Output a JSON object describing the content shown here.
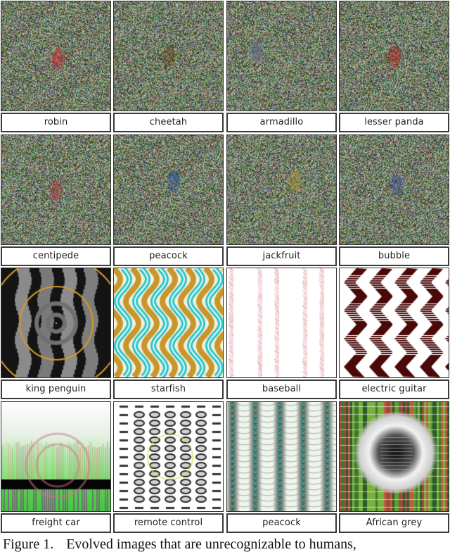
{
  "figure": {
    "rows": [
      {
        "style": "noise",
        "cells": [
          {
            "label": "robin",
            "blob_color": "#c0393a",
            "blob_pos": [
              0.52,
              0.52
            ]
          },
          {
            "label": "cheetah",
            "blob_color": "#6a5030",
            "blob_pos": [
              0.5,
              0.5
            ]
          },
          {
            "label": "armadillo",
            "blob_color": "#6b6f80",
            "blob_pos": [
              0.27,
              0.45
            ]
          },
          {
            "label": "lesser panda",
            "blob_color": "#a03a30",
            "blob_pos": [
              0.5,
              0.5
            ]
          }
        ]
      },
      {
        "style": "noise",
        "cells": [
          {
            "label": "centipede",
            "blob_color": "#a04a4a",
            "blob_pos": [
              0.5,
              0.5
            ]
          },
          {
            "label": "peacock",
            "blob_color": "#3a5a8a",
            "blob_pos": [
              0.55,
              0.42
            ]
          },
          {
            "label": "jackfruit",
            "blob_color": "#9a8a3a",
            "blob_pos": [
              0.62,
              0.42
            ]
          },
          {
            "label": "bubble",
            "blob_color": "#4a5a8a",
            "blob_pos": [
              0.52,
              0.45
            ]
          }
        ]
      },
      {
        "style": "pattern",
        "cells": [
          {
            "label": "king penguin",
            "pattern": "king-penguin"
          },
          {
            "label": "starfish",
            "pattern": "starfish"
          },
          {
            "label": "baseball",
            "pattern": "baseball"
          },
          {
            "label": "electric guitar",
            "pattern": "electric-guitar"
          }
        ]
      },
      {
        "style": "pattern",
        "cells": [
          {
            "label": "freight car",
            "pattern": "freight-car"
          },
          {
            "label": "remote control",
            "pattern": "remote-control"
          },
          {
            "label": "peacock",
            "pattern": "peacock"
          },
          {
            "label": "African grey",
            "pattern": "african-grey"
          }
        ]
      }
    ],
    "caption_prefix": "Figure 1.",
    "caption_text": "Evolved images that are unrecognizable to humans,"
  }
}
